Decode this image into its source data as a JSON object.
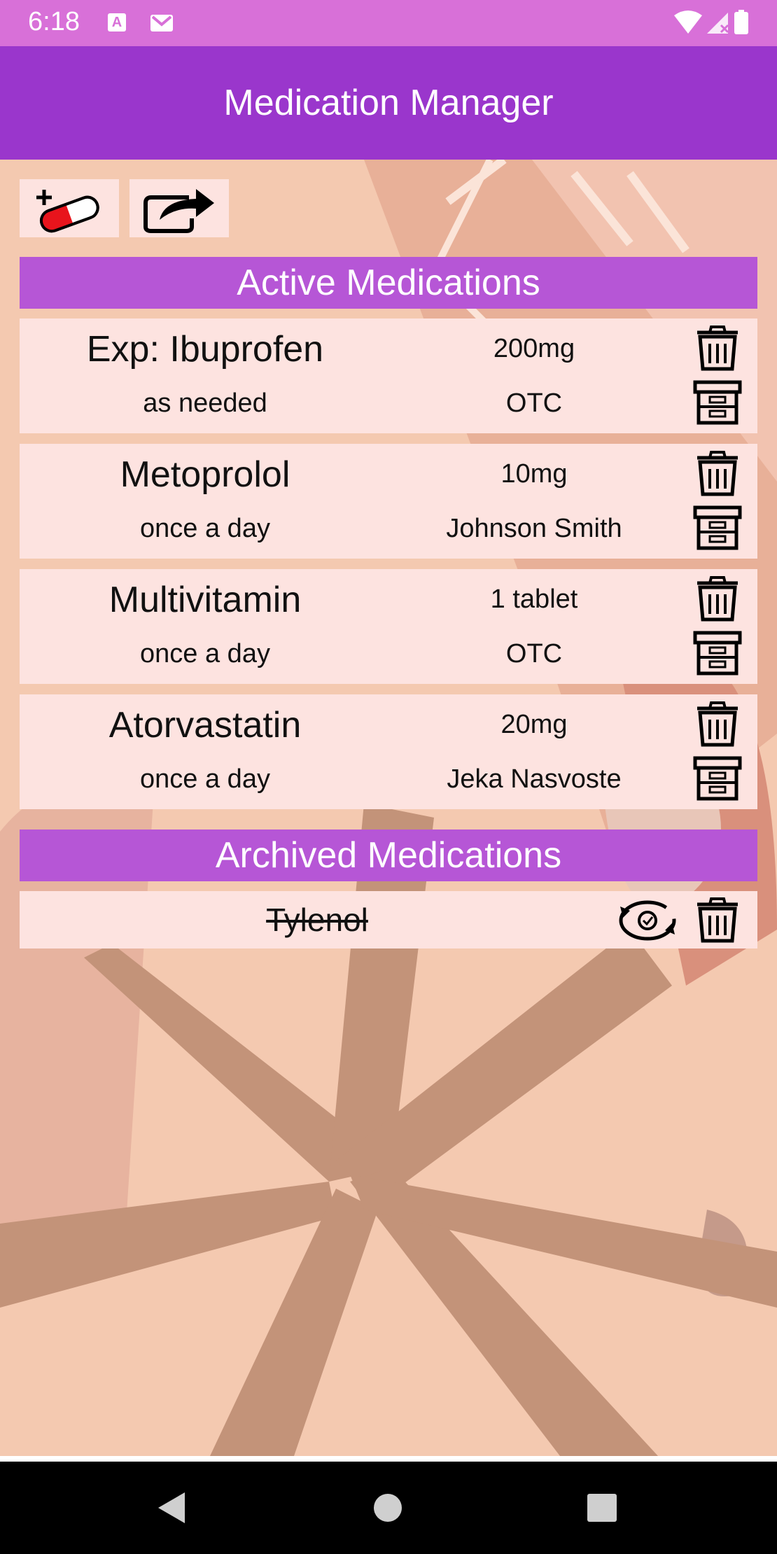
{
  "status_bar": {
    "time": "6:18",
    "notification_badge": "A",
    "icons": [
      "app-notification-icon",
      "gmail-icon",
      "wifi-icon",
      "signal-icon",
      "battery-icon"
    ]
  },
  "app_bar": {
    "title": "Medication Manager"
  },
  "toolbar": {
    "add_icon": "add-medication-icon",
    "share_icon": "share-export-icon"
  },
  "active_section": {
    "title": "Active Medications"
  },
  "active_medications": [
    {
      "name": "Exp: Ibuprofen",
      "dose": "200mg",
      "frequency": "as needed",
      "prescriber": "OTC"
    },
    {
      "name": "Metoprolol",
      "dose": "10mg",
      "frequency": "once a day",
      "prescriber": "Johnson Smith"
    },
    {
      "name": "Multivitamin",
      "dose": "1 tablet",
      "frequency": "once a day",
      "prescriber": "OTC"
    },
    {
      "name": "Atorvastatin",
      "dose": "20mg",
      "frequency": "once a day",
      "prescriber": "Jeka Nasvoste"
    }
  ],
  "archived_section": {
    "title": "Archived Medications"
  },
  "archived_medications": [
    {
      "name": "Tylenol"
    }
  ],
  "colors": {
    "status_bar": "#d870d8",
    "app_bar": "#9a36cc",
    "section_header": "#b656d6",
    "card": "#fde3e0",
    "background": "#f4c9b0"
  }
}
